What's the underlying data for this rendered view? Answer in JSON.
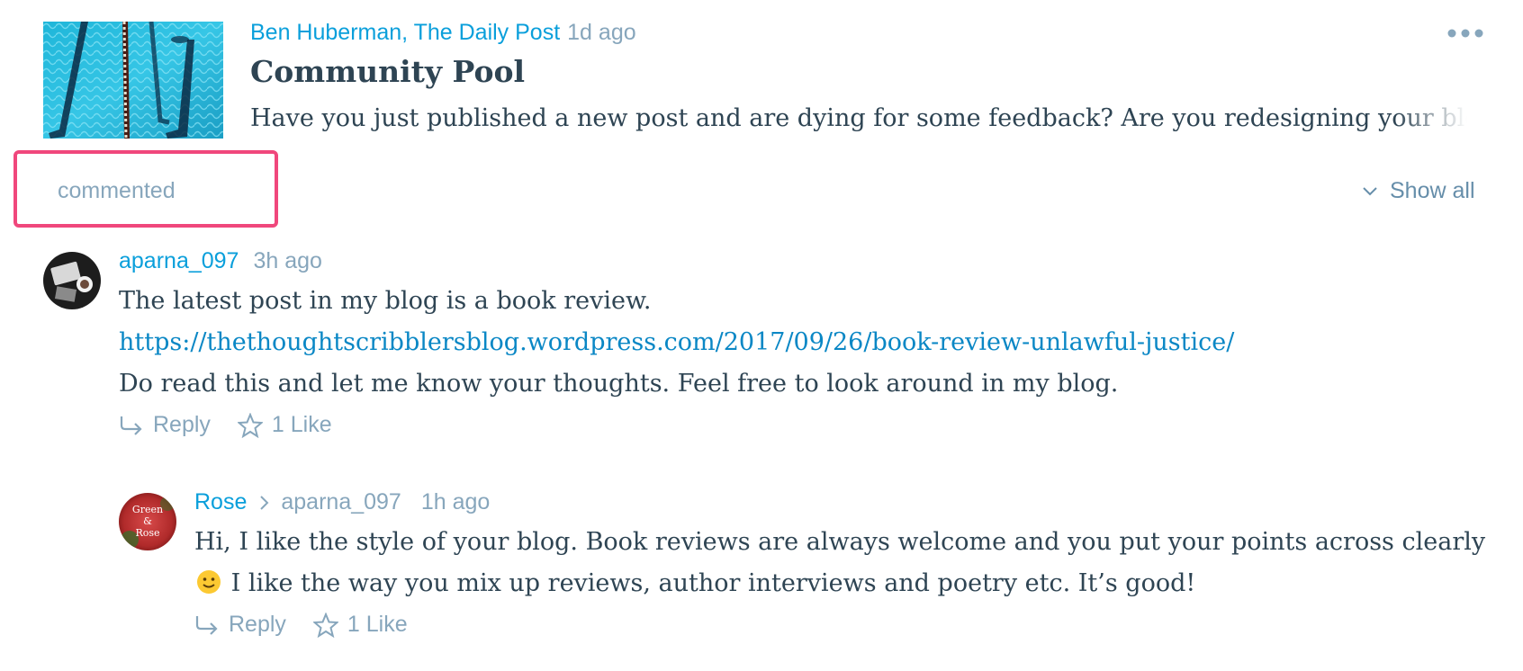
{
  "post": {
    "site": "Ben Huberman, The Daily Post",
    "time": "1d ago",
    "title": "Community Pool",
    "excerpt": "Have you just published a new post and are dying for some feedback? Are you redesigning your blog and want a second pair of eyes?",
    "thumbnail_icon": "swimming-pool-image",
    "more_icon": "ellipsis-icon"
  },
  "activity": {
    "label": "commented",
    "show_all": "Show all",
    "highlight_color": "#f0477c"
  },
  "comments": [
    {
      "author": "aparna_097",
      "time": "3h ago",
      "body_line1": "The latest post in my blog is a book review.",
      "link": "https://thethoughtscribblersblog.wordpress.com/2017/09/26/book-review-unlawful-justice/",
      "body_line3": "Do read this and let me know your thoughts. Feel free to look around in my blog.",
      "reply_label": "Reply",
      "like_label": "1 Like"
    },
    {
      "author": "Rose",
      "in_reply_to": "aparna_097",
      "time": "1h ago",
      "body_part1": "Hi, I like the style of your blog. Book reviews are always welcome and you put your points across clearly",
      "body_part2": "I like the way you mix up reviews, author interviews and poetry etc. It’s good!",
      "emoji": "slightly-smiling-face",
      "avatar_text_1": "Green",
      "avatar_text_2": "&",
      "avatar_text_3": "Rose",
      "reply_label": "Reply",
      "like_label": "1 Like"
    }
  ],
  "colors": {
    "link": "#0a9fdb",
    "meta": "#87a6bc",
    "text": "#2e4453"
  }
}
